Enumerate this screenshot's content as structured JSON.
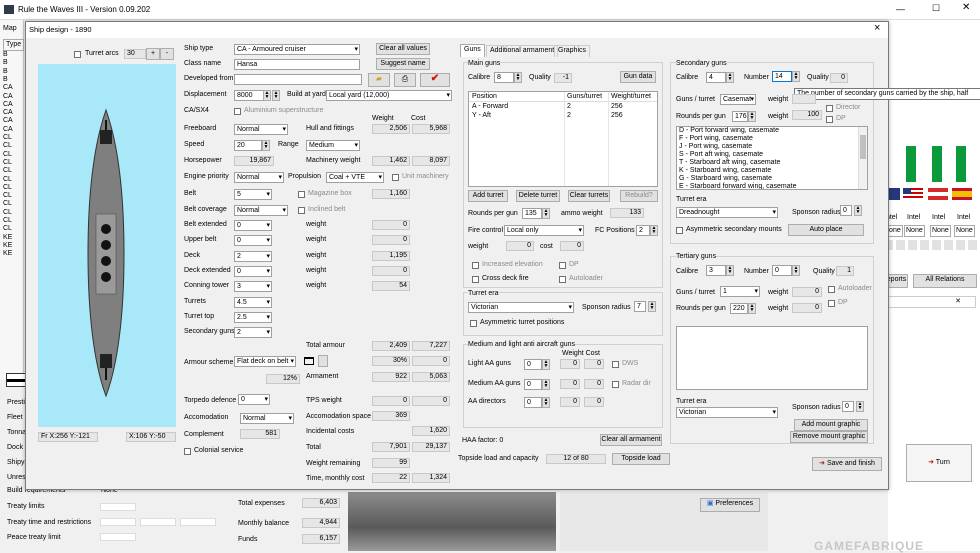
{
  "app": {
    "title": "Rule the Waves III - Version 0.09.202"
  },
  "left_menu": {
    "map": "Map",
    "type_header": "Type",
    "types": [
      "B",
      "B",
      "B",
      "B",
      "CA",
      "CA",
      "CA",
      "CA",
      "CA",
      "CA",
      "CL",
      "CL",
      "CL",
      "CL",
      "CL",
      "CL",
      "CL",
      "CL",
      "CL",
      "CL",
      "CL",
      "CL",
      "KE",
      "KE",
      "KE"
    ]
  },
  "left_labels": [
    "Prestige",
    "Fleet",
    "Tonnage",
    "Dock",
    "Shipyard",
    "Unrest",
    "Build requirements",
    "Treaty limits",
    "Treaty time and restrictions",
    "Peace treaty limit"
  ],
  "build_req_value": "None",
  "bottom_stats": {
    "total_expenses_label": "Total expenses",
    "total_expenses": "6,403",
    "monthly_balance_label": "Monthly balance",
    "monthly_balance": "4,944",
    "funds_label": "Funds",
    "funds": "6,157"
  },
  "right_panel": {
    "intel": [
      "Intel",
      "Intel",
      "Intel",
      "Intel"
    ],
    "none": [
      "None",
      "None",
      "None",
      "None"
    ],
    "reports": "Reports",
    "all_relations": "All Relations",
    "turn": "Turn",
    "preferences": "Preferences",
    "watermark": "GAMEFABRIQUE"
  },
  "dialog": {
    "title": "Ship design - 1890",
    "close": "×",
    "turret_arcs": "Turret arcs",
    "arc_value": "30",
    "coords_left": "Fr X:256 Y:-121",
    "coords_right": "X:106 Y:-50",
    "ship_type_label": "Ship type",
    "ship_type": "CA - Armoured cruiser",
    "class_name_label": "Class name",
    "class_name": "Hansa",
    "developed_from_label": "Developed from",
    "developed_from": "",
    "displacement_label": "Displacement",
    "displacement": "8000",
    "build_at_yard_label": "Build at yard",
    "build_at_yard": "Local yard (12,000)",
    "clear_all_values": "Clear all values",
    "suggest_name": "Suggest name",
    "caex4": "CA/SX4",
    "aluminium": "Aluminium superstructure",
    "weight_header": "Weight",
    "cost_header": "Cost",
    "freeboard_label": "Freeboard",
    "freeboard": "Normal",
    "hull_fittings_label": "Hull and fittings",
    "hull_weight": "2,506",
    "hull_cost": "5,968",
    "speed_label": "Speed",
    "speed": "20",
    "range_label": "Range",
    "range": "Medium",
    "horsepower_label": "Horsepower",
    "horsepower": "19,867",
    "machinery_label": "Machinery weight",
    "mach_weight": "1,462",
    "mach_cost": "8,097",
    "engine_priority_label": "Engine priority",
    "engine_priority": "Normal",
    "propulsion_label": "Propulsion",
    "propulsion": "Coal + VTE",
    "unit_machinery": "Unit machinery",
    "belt_label": "Belt",
    "belt": "5",
    "magazine_box": "Magazine box",
    "belt_weight": "1,160",
    "belt_coverage_label": "Belt coverage",
    "belt_coverage": "Normal",
    "inclined_belt": "Inclined belt",
    "belt_extended_label": "Belt extended",
    "belt_extended": "0",
    "belt_ext_weight_label": "weight",
    "belt_ext_weight": "0",
    "upper_belt_label": "Upper belt",
    "upper_belt": "0",
    "upper_weight_label": "weight",
    "upper_weight": "0",
    "deck_label": "Deck",
    "deck": "2",
    "deck_weight_label": "weight",
    "deck_weight": "1,195",
    "deck_extended_label": "Deck extended",
    "deck_extended": "0",
    "deck_ext_weight_label": "weight",
    "deck_ext_weight": "0",
    "conning_label": "Conning tower",
    "conning": "3",
    "conning_weight_label": "weight",
    "conning_weight": "54",
    "turrets_label": "Turrets",
    "turrets": "4.5",
    "turret_top_label": "Turret top",
    "turret_top": "2.5",
    "secondary_guns_label": "Secondary guns",
    "secondary_guns": "2",
    "total_armour_label": "Total armour",
    "armour_weight": "2,409",
    "armour_cost": "7,227",
    "armour_scheme_label": "Armour scheme",
    "armour_scheme": "Flat deck on belt",
    "armour_pct": "30%",
    "armour_pct_cost": "0",
    "armour_pct2": "12%",
    "armament_label": "Armament",
    "armament_weight": "922",
    "armament_cost": "5,063",
    "torpedo_label": "Torpedo defence",
    "torpedo": "0",
    "tps_label": "TPS weight",
    "tps_weight": "0",
    "tps_cost": "0",
    "accom_label": "Accomodation",
    "accom": "Normal",
    "accom_space_label": "Accomodation space",
    "accom_space": "369",
    "complement_label": "Complement",
    "complement": "581",
    "incidental_label": "Incidental costs",
    "incidental": "1,620",
    "colonial_label": "Colonial service",
    "total_label": "Total",
    "total_weight": "7,901",
    "total_cost": "29,137",
    "weight_remaining_label": "Weight remaining",
    "weight_remaining": "99",
    "time_cost_label": "Time, monthly cost",
    "time": "22",
    "monthly_cost": "1,324",
    "tabs": [
      "Guns",
      "Additional armament",
      "Graphics"
    ],
    "main_guns": {
      "title": "Main guns",
      "calibre_label": "Calibre",
      "calibre": "8",
      "quality_label": "Quality",
      "quality": "-1",
      "gun_data": "Gun data",
      "headers": [
        "Position",
        "Guns/turret",
        "Weight/turret"
      ],
      "rows": [
        [
          "A - Forward",
          "2",
          "256"
        ],
        [
          "Y - Aft",
          "2",
          "256"
        ]
      ],
      "add_turret": "Add turret",
      "delete_turret": "Delete turret",
      "clear_turrets": "Clear turrets",
      "rebuild": "Rebuild?",
      "rounds_label": "Rounds per gun",
      "rounds": "135",
      "ammo_label": "ammo weight",
      "ammo": "133",
      "fire_control_label": "Fire control",
      "fire_control": "Local only",
      "fc_positions_label": "FC Positions",
      "fc_positions": "2",
      "weight_label": "weight",
      "weight": "0",
      "cost_label": "cost",
      "cost": "0",
      "increased_elev": "Increased elevation",
      "dp": "DP",
      "cross_deck": "Cross deck fire",
      "autoloader": "Autoloader"
    },
    "turret_era_main": {
      "title": "Turret era",
      "era": "Victorian",
      "sponson_label": "Sponson radius",
      "sponson": "7",
      "asym": "Asymmetric turret positions"
    },
    "aa": {
      "title": "Medium and light anti aircraft guns",
      "weight_cost": "Weight  Cost",
      "light_label": "Light AA guns",
      "light": "0",
      "medium_label": "Medium AA guns",
      "medium": "0",
      "directors_label": "AA directors",
      "directors": "0",
      "dws": "DWS",
      "radar": "Radar dir",
      "v": "0"
    },
    "haa_label": "HAA factor: 0",
    "clear_armament": "Clear all armament",
    "topside_label": "Topside load and capacity",
    "topside": "12 of 80",
    "topside_btn": "Topside load",
    "secondary": {
      "title": "Secondary guns",
      "calibre_label": "Calibre",
      "calibre": "4",
      "number_label": "Number",
      "number": "14",
      "quality_label": "Quality",
      "quality": "0",
      "guns_turret_label": "Guns / turret",
      "guns_turret": "Casemat",
      "weight_label": "weight",
      "weight": "",
      "rounds_label": "Rounds per gun",
      "rounds": "176",
      "weight2": "100",
      "director": "Director",
      "dp": "DP",
      "positions": [
        "D - Port forward wing, casemate",
        "F - Port wing, casemate",
        "J - Port wing, casemate",
        "S - Port aft wing, casemate",
        "T - Starboard aft wing, casemate",
        "K - Starboard wing, casemate",
        "G - Starboard wing, casemate",
        "E - Starboard forward wing, casemate"
      ],
      "tooltip": "The number of secondary guns carried by the ship, half"
    },
    "turret_era_sec": {
      "title": "Turret era",
      "era": "Dreadnought",
      "sponson_label": "Sponson radius",
      "sponson": "0",
      "asym": "Asymmetric secondary mounts",
      "auto_place": "Auto place"
    },
    "tertiary": {
      "title": "Tertiary guns",
      "calibre_label": "Calibre",
      "calibre": "3",
      "number_label": "Number",
      "number": "0",
      "quality_label": "Quality",
      "quality": "1",
      "guns_turret_label": "Guns / turret",
      "guns_turret": "1",
      "weight_label": "weight",
      "weight": "0",
      "rounds_label": "Rounds per gun",
      "rounds": "220",
      "weight2": "0",
      "autoloader": "Autoloader",
      "dp": "DP"
    },
    "turret_era_ter": {
      "title": "Turret era",
      "era": "Victorian",
      "sponson_label": "Sponson radius",
      "sponson": "0",
      "add_mount": "Add mount graphic",
      "remove_mount": "Remove mount graphic"
    },
    "save_finish": "Save and finish"
  },
  "colors": {
    "accent": "#0078d7",
    "ship_bg": "#a8e8f8",
    "hull": "#7a7a7a",
    "flag_green": "#0a9a3c"
  }
}
